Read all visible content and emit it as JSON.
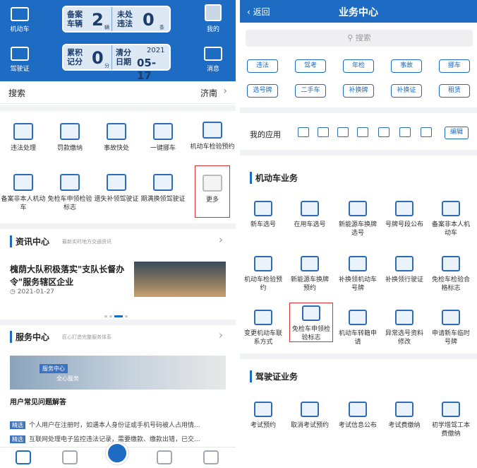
{
  "left": {
    "header": {
      "icons": [
        {
          "label": "机动车",
          "icon": "car-card-icon"
        },
        {
          "label": "驾驶证",
          "icon": "license-icon"
        },
        {
          "label": "我的",
          "icon": "person-icon"
        },
        {
          "label": "消息",
          "icon": "mail-icon"
        }
      ],
      "card1": {
        "label1": "备案车辆",
        "value1": "2",
        "unit1": "辆",
        "label2": "未处违法",
        "value2": "0",
        "unit2": "条"
      },
      "card2": {
        "label1": "累积记分",
        "value1": "0",
        "unit1": "分",
        "label2": "清分日期",
        "year": "2021",
        "date": "05-17"
      }
    },
    "search": {
      "label": "搜索",
      "city": "济南"
    },
    "grid": [
      {
        "label": "违法处理"
      },
      {
        "label": "罚款缴纳"
      },
      {
        "label": "事故快处"
      },
      {
        "label": "一键挪车"
      },
      {
        "label": "机动车检验预约"
      },
      {
        "label": "备案非本人机动车"
      },
      {
        "label": "免检车申领检验标志"
      },
      {
        "label": "遗失补领驾驶证"
      },
      {
        "label": "期满换领驾驶证"
      },
      {
        "label": "更多"
      }
    ],
    "news": {
      "title": "资讯中心",
      "subtitle": "最新实时地方交通资讯",
      "headline": "槐荫大队积极落实\"支队长督办令\"服务辖区企业",
      "date": "2021-01-27"
    },
    "service": {
      "title": "服务中心",
      "subtitle": "匠心打造完整服务体系",
      "banner_tag": "服务中心",
      "banner_text": "全心服务",
      "faq_title": "用户常见问题解答",
      "faq": [
        {
          "tag": "精选",
          "text": "个人用户在注册时，如遇本人身份证或手机号码被人占用情..."
        },
        {
          "tag": "精选",
          "text": "互联网处理电子监控违法记录，需要缴款、缴款出错，已交..."
        }
      ]
    },
    "tabbar": [
      "home-icon",
      "monitor-icon",
      "scan-icon",
      "user-icon",
      "heart-icon"
    ]
  },
  "right": {
    "header": {
      "back": "返回",
      "title": "业务中心"
    },
    "search_placeholder": "搜索",
    "pills_row1": [
      "违法",
      "驾考",
      "年检",
      "事故",
      "挪车"
    ],
    "pills_row2": [
      "选号牌",
      "二手车",
      "补换牌",
      "补换证",
      "租赁"
    ],
    "my_apps": {
      "label": "我的应用",
      "edit": "编辑"
    },
    "vehicle": {
      "title": "机动车业务",
      "items": [
        "新车选号",
        "在用车选号",
        "新能源车换牌选号",
        "号牌号段公布",
        "备案非本人机动车",
        "机动车检验预约",
        "新能源车换牌预约",
        "补换领机动车号牌",
        "补换领行驶证",
        "免检车检验合格标志",
        "变更机动车联系方式",
        "免检车申领检验标志",
        "机动车转籍申请",
        "异常选号资料修改",
        "申请新车临时号牌"
      ]
    },
    "license": {
      "title": "驾驶证业务",
      "items": [
        "考试预约",
        "取消考试预约",
        "考试信息公布",
        "考试费缴纳",
        "初学增驾工本费缴纳"
      ]
    }
  }
}
